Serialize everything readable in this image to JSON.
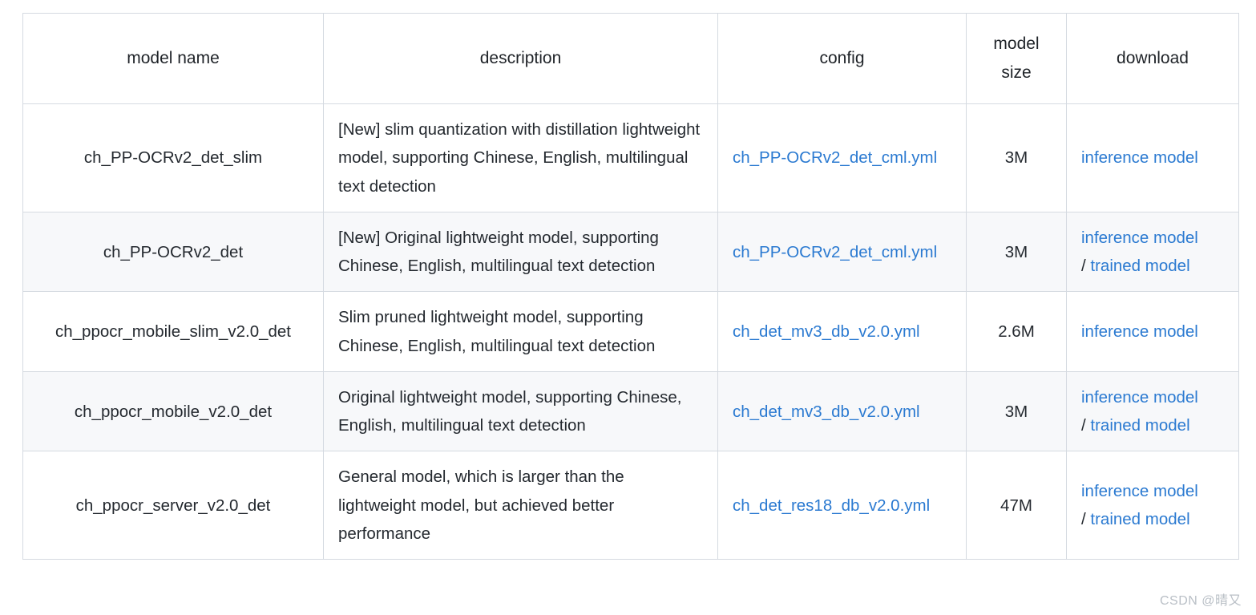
{
  "table": {
    "columns": [
      {
        "key": "model_name",
        "label": "model name"
      },
      {
        "key": "description",
        "label": "description"
      },
      {
        "key": "config",
        "label": "config"
      },
      {
        "key": "model_size",
        "label": "model\nsize"
      },
      {
        "key": "download",
        "label": "download"
      }
    ],
    "header": {
      "model_name": "model name",
      "description": "description",
      "config": "config",
      "model_size_line1": "model",
      "model_size_line2": "size",
      "download": "download"
    },
    "rows": [
      {
        "model_name": "ch_PP-OCRv2_det_slim",
        "description": "[New] slim quantization with distillation lightweight model, supporting Chinese, English, multilingual text detection",
        "config": "ch_PP-OCRv2_det_cml.yml",
        "model_size": "3M",
        "download": {
          "inference": "inference model",
          "separator": "",
          "trained": ""
        }
      },
      {
        "model_name": "ch_PP-OCRv2_det",
        "description": "[New] Original lightweight model, supporting Chinese, English, multilingual text detection",
        "config": "ch_PP-OCRv2_det_cml.yml",
        "model_size": "3M",
        "download": {
          "inference": "inference model",
          "separator": "/",
          "trained": "trained model"
        }
      },
      {
        "model_name": "ch_ppocr_mobile_slim_v2.0_det",
        "description": "Slim pruned lightweight model, supporting Chinese, English, multilingual text detection",
        "config": "ch_det_mv3_db_v2.0.yml",
        "model_size": "2.6M",
        "download": {
          "inference": "inference model",
          "separator": "",
          "trained": ""
        }
      },
      {
        "model_name": "ch_ppocr_mobile_v2.0_det",
        "description": "Original lightweight model, supporting Chinese, English, multilingual text detection",
        "config": "ch_det_mv3_db_v2.0.yml",
        "model_size": "3M",
        "download": {
          "inference": "inference model",
          "separator": "/",
          "trained": "trained model"
        }
      },
      {
        "model_name": "ch_ppocr_server_v2.0_det",
        "description": "General model, which is larger than the lightweight model, but achieved better performance",
        "config": "ch_det_res18_db_v2.0.yml",
        "model_size": "47M",
        "download": {
          "inference": "inference model",
          "separator": "/",
          "trained": "trained model"
        }
      }
    ]
  },
  "watermark": {
    "text": "CSDN @晴又"
  },
  "colors": {
    "link": "#2b7ad1",
    "border": "#d5dae1",
    "row_alt_bg": "#f7f8fa",
    "text": "#24292f",
    "watermark": "#b9bfc6"
  }
}
